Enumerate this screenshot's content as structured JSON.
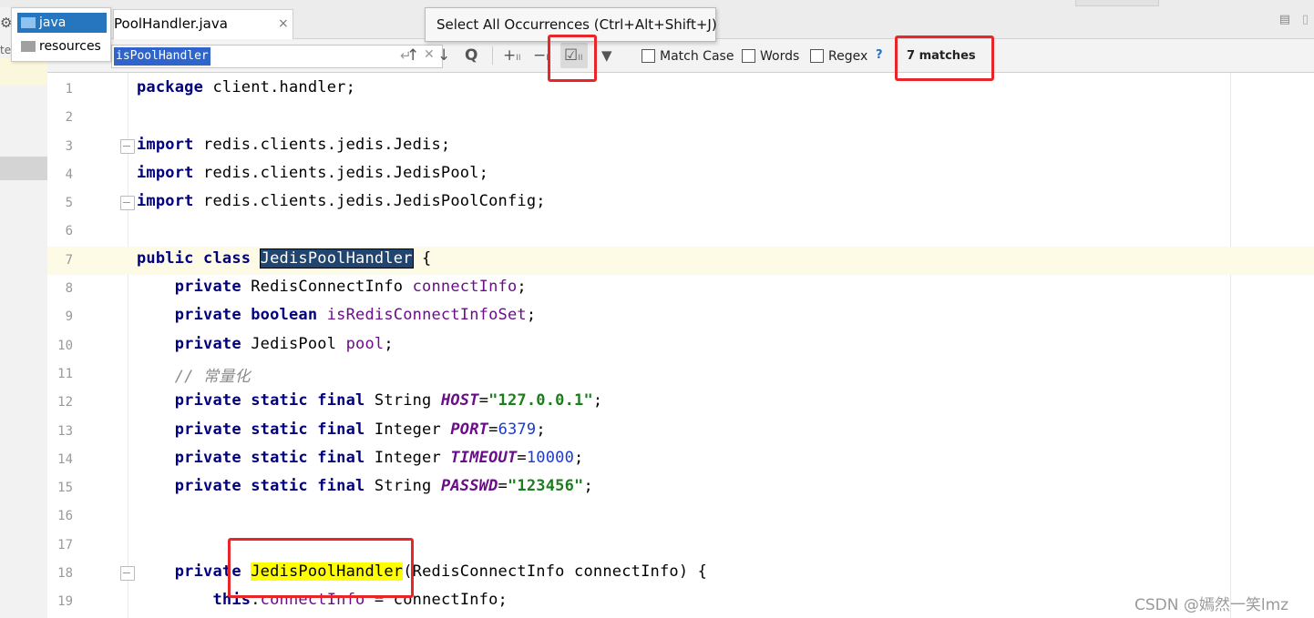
{
  "tree_popup": {
    "items": [
      {
        "label": "java"
      },
      {
        "label": "resources"
      }
    ]
  },
  "left_panel": {
    "cut_text": "te"
  },
  "tab": {
    "label": "PoolHandler.java",
    "close": "×"
  },
  "search": {
    "value": "isPoolHandler",
    "prev_occurrence": "↑",
    "next_occurrence": "↓",
    "find_all": "Q",
    "add_occurrence": "+",
    "remove_occurrence": "−",
    "select_all_occurrences": "☑",
    "filter": "▼",
    "match_case_label": "Match Case",
    "words_label": "Words",
    "regex_label": "Regex",
    "help": "?",
    "matches_label": "7 matches"
  },
  "tooltip": {
    "text": "Select All Occurrences (Ctrl+Alt+Shift+J)"
  },
  "code_lines": [
    {
      "n": "1"
    },
    {
      "n": "2"
    },
    {
      "n": "3"
    },
    {
      "n": "4"
    },
    {
      "n": "5"
    },
    {
      "n": "6"
    },
    {
      "n": "7"
    },
    {
      "n": "8"
    },
    {
      "n": "9"
    },
    {
      "n": "10"
    },
    {
      "n": "11"
    },
    {
      "n": "12"
    },
    {
      "n": "13"
    },
    {
      "n": "14"
    },
    {
      "n": "15"
    },
    {
      "n": "16"
    },
    {
      "n": "17"
    },
    {
      "n": "18"
    },
    {
      "n": "19"
    }
  ],
  "code": {
    "l1": [
      "package",
      " client.handler;"
    ],
    "l3": [
      "import",
      " redis.clients.jedis.Jedis;"
    ],
    "l4": [
      "import",
      " redis.clients.jedis.JedisPool;"
    ],
    "l5": [
      "import",
      " redis.clients.jedis.JedisPoolConfig;"
    ],
    "l7": [
      "public class",
      " ",
      "JedisPoolHandler",
      " {"
    ],
    "l8": [
      "private",
      " RedisConnectInfo ",
      "connectInfo",
      ";"
    ],
    "l9": [
      "private boolean",
      " ",
      "isRedisConnectInfoSet",
      ";"
    ],
    "l10": [
      "private",
      " JedisPool ",
      "pool",
      ";"
    ],
    "l11": [
      "// 常量化"
    ],
    "l12": [
      "private static final",
      " String ",
      "HOST",
      "=",
      "\"127.0.0.1\"",
      ";"
    ],
    "l13": [
      "private static final",
      " Integer ",
      "PORT",
      "=",
      "6379",
      ";"
    ],
    "l14": [
      "private static final",
      " Integer ",
      "TIMEOUT",
      "=",
      "10000",
      ";"
    ],
    "l15": [
      "private static final",
      " String ",
      "PASSWD",
      "=",
      "\"123456\"",
      ";"
    ],
    "l18": [
      "private",
      " ",
      "JedisPoolHandler",
      "(RedisConnectInfo connectInfo) {"
    ],
    "l19": [
      "this",
      ".",
      "connectInfo",
      " = connectInfo;"
    ]
  },
  "watermark": "CSDN @嫣然一笑lmz",
  "colors": {
    "selection": "#21456e",
    "occurrence": "#ffff00",
    "annotation": "#e8262a"
  }
}
